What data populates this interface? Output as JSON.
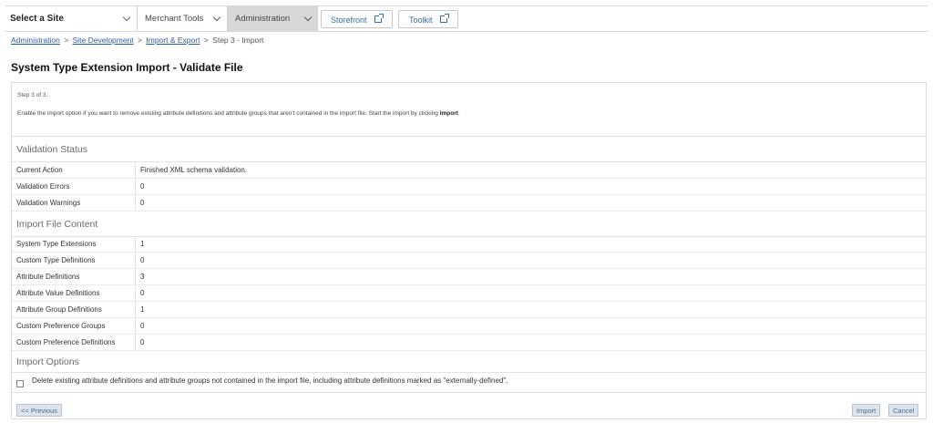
{
  "topnav": {
    "site_select": "Select a Site",
    "menus": [
      "Merchant Tools",
      "Administration"
    ],
    "storefront": "Storefront",
    "toolkit": "Toolkit"
  },
  "breadcrumb": {
    "items": [
      "Administration",
      "Site Development",
      "Import & Export"
    ],
    "current": "Step 3 - Import",
    "separator": ">"
  },
  "page_title": "System Type Extension Import - Validate File",
  "intro": {
    "step": "Step 3 of 3.",
    "desc_prefix": "Enable the import option if you want to remove existing attribute definitions and attribute groups that aren't contained in the import file. Start the import by clicking ",
    "desc_bold": "Import",
    "desc_suffix": "."
  },
  "validation": {
    "title": "Validation Status",
    "rows": [
      {
        "label": "Current Action",
        "value": "Finished XML schema validation."
      },
      {
        "label": "Validation Errors",
        "value": "0"
      },
      {
        "label": "Validation Warnings",
        "value": "0"
      }
    ]
  },
  "content": {
    "title": "Import File Content",
    "rows": [
      {
        "label": "System Type Extensions",
        "value": "1"
      },
      {
        "label": "Custom Type Definitions",
        "value": "0"
      },
      {
        "label": "Attribute Definitions",
        "value": "3"
      },
      {
        "label": "Attribute Value Definitions",
        "value": "0"
      },
      {
        "label": "Attribute Group Definitions",
        "value": "1"
      },
      {
        "label": "Custom Preference Groups",
        "value": "0"
      },
      {
        "label": "Custom Preference Definitions",
        "value": "0"
      }
    ]
  },
  "options": {
    "title": "Import Options",
    "delete_label": "Delete existing attribute definitions and attribute groups not contained in the import file, including attribute definitions marked as \"externally-defined\"."
  },
  "buttons": {
    "previous": "<< Previous",
    "import": "Import",
    "cancel": "Cancel"
  }
}
